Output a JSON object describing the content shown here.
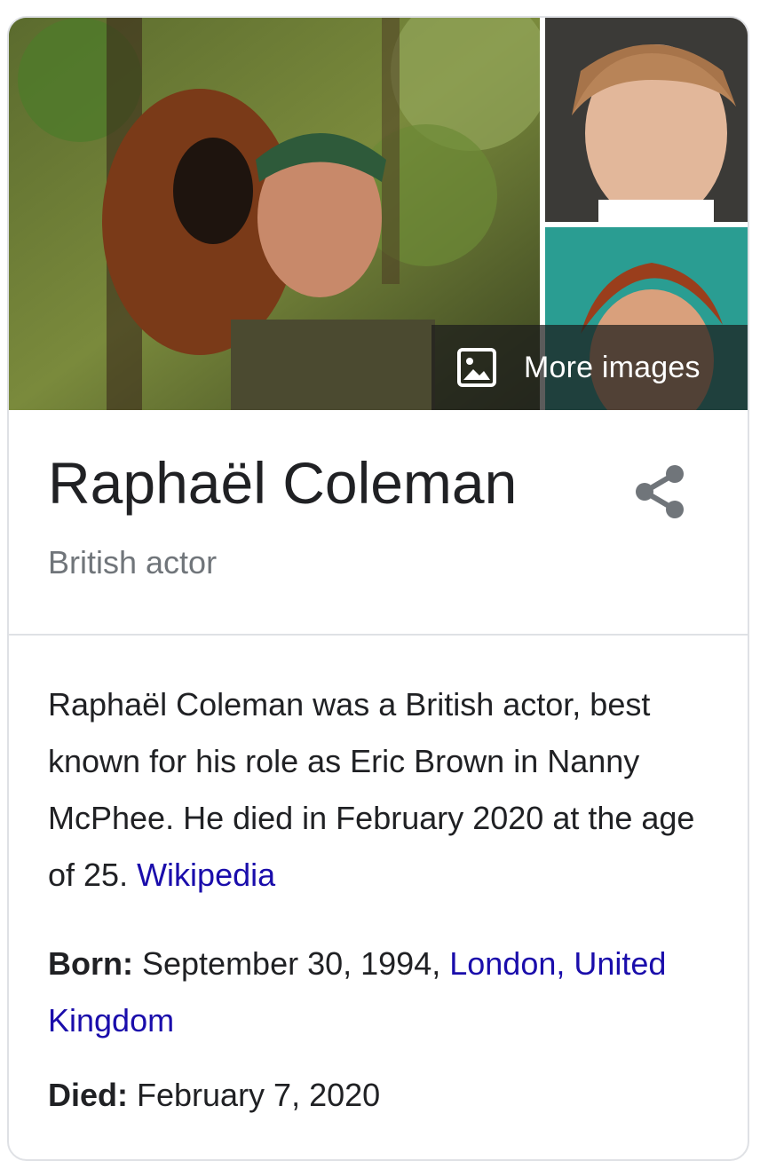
{
  "images": {
    "more_images_label": "More images"
  },
  "entity": {
    "title": "Raphaël Coleman",
    "subtitle": "British actor"
  },
  "description": {
    "text": "Raphaël Coleman was a British actor, best known for his role as Eric Brown in Nanny McPhee. He died in February 2020 at the age of 25. ",
    "source_link": "Wikipedia"
  },
  "facts": {
    "born": {
      "label": "Born:",
      "value": " September 30, 1994, ",
      "place_link": "London, United Kingdom"
    },
    "died": {
      "label": "Died:",
      "value": " February 7, 2020"
    }
  },
  "colors": {
    "title": "#202124",
    "subtitle": "#70757a",
    "link": "#1a0dab",
    "border": "#dfe1e5",
    "overlay": "#1c1c1c"
  }
}
